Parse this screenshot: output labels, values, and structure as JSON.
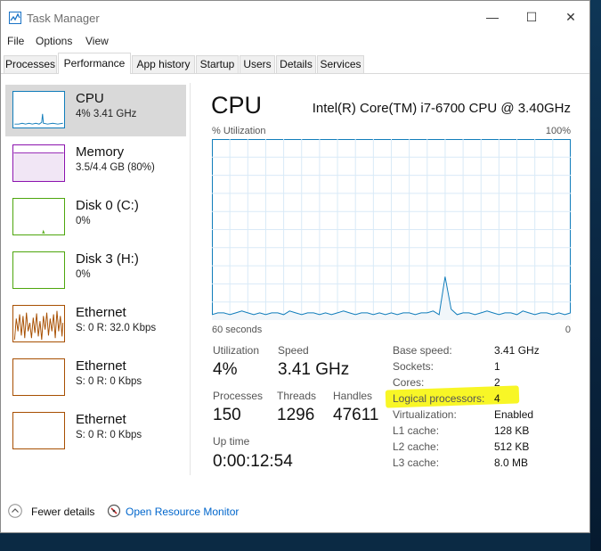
{
  "window": {
    "title": "Task Manager",
    "controls": {
      "minimize": "—",
      "maximize": "☐",
      "close": "✕"
    }
  },
  "menu": [
    "File",
    "Options",
    "View"
  ],
  "tabs": [
    {
      "label": "Processes",
      "active": false
    },
    {
      "label": "Performance",
      "active": true
    },
    {
      "label": "App history",
      "active": false
    },
    {
      "label": "Startup",
      "active": false
    },
    {
      "label": "Users",
      "active": false
    },
    {
      "label": "Details",
      "active": false
    },
    {
      "label": "Services",
      "active": false
    }
  ],
  "sidebar": {
    "items": [
      {
        "name": "CPU",
        "sub": "4% 3.41 GHz",
        "selected": true,
        "color": "#117dbb",
        "icon": "cpu-graph-icon"
      },
      {
        "name": "Memory",
        "sub": "3.5/4.4 GB (80%)",
        "selected": false,
        "color": "#8b12ae",
        "icon": "memory-graph-icon"
      },
      {
        "name": "Disk 0 (C:)",
        "sub": "0%",
        "selected": false,
        "color": "#4da60c",
        "icon": "disk-graph-icon"
      },
      {
        "name": "Disk 3 (H:)",
        "sub": "0%",
        "selected": false,
        "color": "#4da60c",
        "icon": "disk-graph-icon"
      },
      {
        "name": "Ethernet",
        "sub": "S: 0 R: 32.0 Kbps",
        "selected": false,
        "color": "#a74f01",
        "icon": "network-graph-icon"
      },
      {
        "name": "Ethernet",
        "sub": "S: 0 R: 0 Kbps",
        "selected": false,
        "color": "#a74f01",
        "icon": "network-graph-icon"
      },
      {
        "name": "Ethernet",
        "sub": "S: 0 R: 0 Kbps",
        "selected": false,
        "color": "#a74f01",
        "icon": "network-graph-icon"
      }
    ]
  },
  "main": {
    "title": "CPU",
    "model": "Intel(R) Core(TM) i7-6700 CPU @ 3.40GHz",
    "graph": {
      "y_label": "% Utilization",
      "y_max_label": "100%",
      "x_left_label": "60 seconds",
      "x_right_label": "0",
      "line_color": "#117dbb",
      "samples": [
        3,
        4,
        4,
        3,
        4,
        5,
        4,
        3,
        4,
        3,
        4,
        4,
        3,
        5,
        4,
        3,
        4,
        4,
        3,
        4,
        3,
        4,
        5,
        4,
        3,
        4,
        4,
        3,
        4,
        3,
        4,
        3,
        4,
        4,
        3,
        4,
        4,
        5,
        3,
        24,
        6,
        3,
        4,
        4,
        3,
        4,
        5,
        4,
        3,
        4,
        4,
        3,
        5,
        4,
        3,
        4,
        4,
        3,
        4,
        3,
        4
      ]
    },
    "stats": {
      "utilization": {
        "label": "Utilization",
        "value": "4%"
      },
      "speed": {
        "label": "Speed",
        "value": "3.41 GHz"
      },
      "processes": {
        "label": "Processes",
        "value": "150"
      },
      "threads": {
        "label": "Threads",
        "value": "1296"
      },
      "handles": {
        "label": "Handles",
        "value": "47611"
      },
      "uptime": {
        "label": "Up time",
        "value": "0:00:12:54"
      }
    },
    "specs": [
      {
        "label": "Base speed:",
        "value": "3.41 GHz"
      },
      {
        "label": "Sockets:",
        "value": "1"
      },
      {
        "label": "Cores:",
        "value": "2"
      },
      {
        "label": "Logical processors:",
        "value": "4",
        "highlighted": true
      },
      {
        "label": "Virtualization:",
        "value": "Enabled"
      },
      {
        "label": "L1 cache:",
        "value": "128 KB"
      },
      {
        "label": "L2 cache:",
        "value": "512 KB"
      },
      {
        "label": "L3 cache:",
        "value": "8.0 MB"
      }
    ]
  },
  "footer": {
    "fewer_details": "Fewer details",
    "resource_monitor": "Open Resource Monitor"
  }
}
